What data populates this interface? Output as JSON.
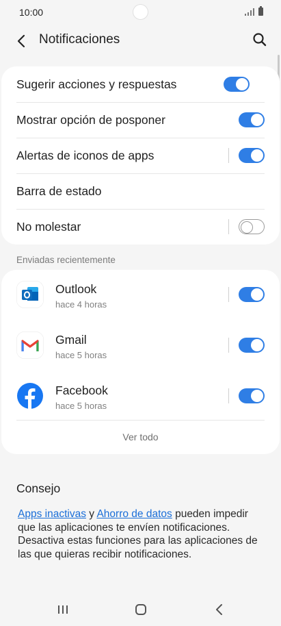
{
  "status_bar": {
    "time": "10:00"
  },
  "app_bar": {
    "title": "Notificaciones"
  },
  "settings": [
    {
      "label": "Sugerir acciones y respuestas",
      "toggle": "on",
      "separator": false
    },
    {
      "label": "Mostrar opción de posponer",
      "toggle": "on",
      "separator": false
    },
    {
      "label": "Alertas de iconos de apps",
      "toggle": "on",
      "separator": true
    },
    {
      "label": "Barra de estado",
      "toggle": null,
      "separator": false
    },
    {
      "label": "No molestar",
      "toggle": "off",
      "separator": true
    }
  ],
  "recent": {
    "header": "Enviadas recientemente",
    "apps": [
      {
        "name": "Outlook",
        "time": "hace 4 horas",
        "icon": "outlook-icon",
        "toggle": "on"
      },
      {
        "name": "Gmail",
        "time": "hace 5 horas",
        "icon": "gmail-icon",
        "toggle": "on"
      },
      {
        "name": "Facebook",
        "time": "hace 5 horas",
        "icon": "facebook-icon",
        "toggle": "on"
      }
    ],
    "see_all": "Ver todo"
  },
  "tip": {
    "title": "Consejo",
    "link1": "Apps inactivas",
    "conjunction": " y ",
    "link2": "Ahorro de datos",
    "rest": " pueden impedir que las aplicaciones te envíen notificaciones. Desactiva estas funciones para las aplicaciones de las que quieras recibir notificaciones."
  },
  "colors": {
    "accent": "#2f7ee5",
    "link": "#1a6ed8",
    "background": "#f5f5f5"
  }
}
